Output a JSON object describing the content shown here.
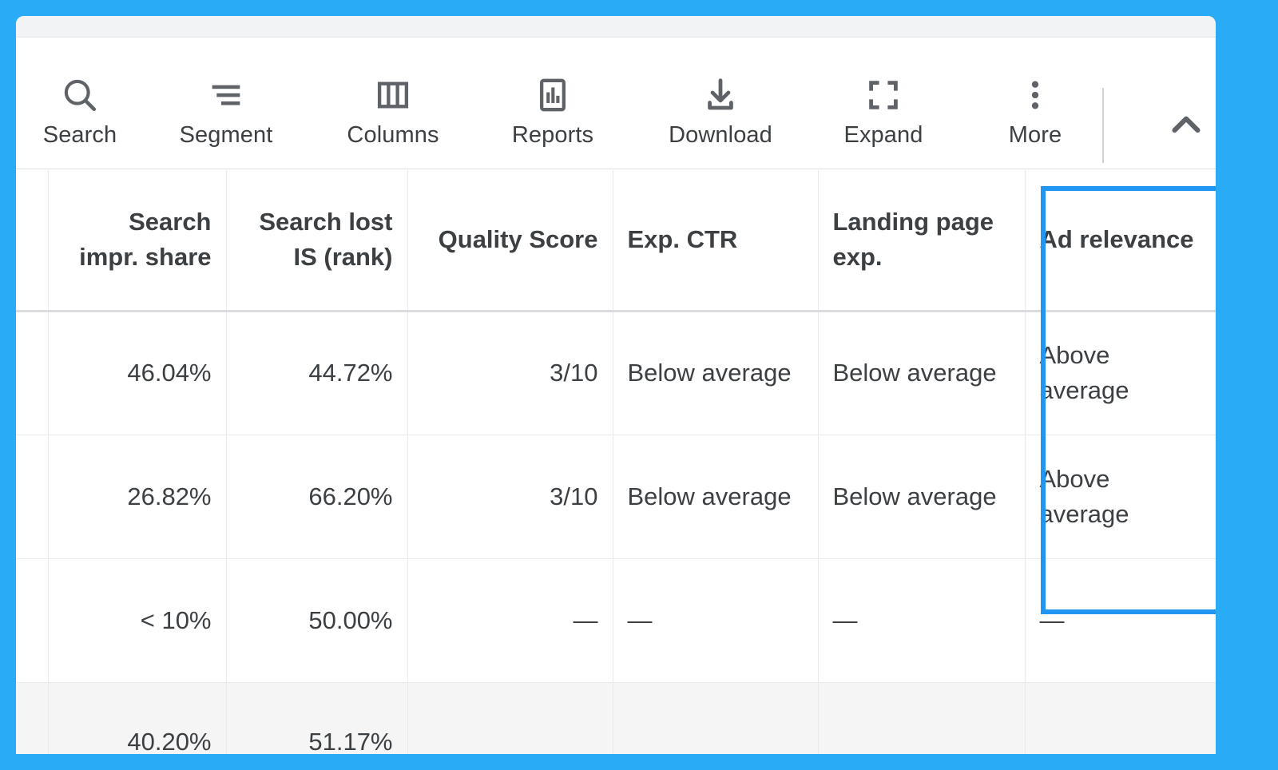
{
  "theme": {
    "accent": "#2196f3",
    "text": "#3c4043",
    "grid_line": "#e8eaed",
    "strip": "#f1f3f4"
  },
  "toolbar": {
    "items": [
      {
        "label": "Search",
        "icon": "search-icon"
      },
      {
        "label": "Segment",
        "icon": "segment-icon"
      },
      {
        "label": "Columns",
        "icon": "columns-icon"
      },
      {
        "label": "Reports",
        "icon": "reports-icon"
      },
      {
        "label": "Download",
        "icon": "download-icon"
      },
      {
        "label": "Expand",
        "icon": "expand-icon"
      },
      {
        "label": "More",
        "icon": "more-vert-icon"
      }
    ],
    "collapse_icon": "chevron-up-icon"
  },
  "table": {
    "columns": [
      {
        "id": "search_impr_share",
        "header": "Search impr. share",
        "align": "right"
      },
      {
        "id": "search_lost_is_rank",
        "header": "Search lost IS (rank)",
        "align": "right"
      },
      {
        "id": "quality_score",
        "header": "Quality Score",
        "align": "right"
      },
      {
        "id": "exp_ctr",
        "header": "Exp. CTR",
        "align": "left"
      },
      {
        "id": "landing_page_exp",
        "header": "Landing page exp.",
        "align": "left"
      },
      {
        "id": "ad_relevance",
        "header": "Ad relevance",
        "align": "left",
        "highlighted": true
      }
    ],
    "rows": [
      {
        "search_impr_share": "46.04%",
        "search_lost_is_rank": "44.72%",
        "quality_score": "3/10",
        "exp_ctr": "Below average",
        "landing_page_exp": "Below average",
        "ad_relevance": "Above average"
      },
      {
        "search_impr_share": "26.82%",
        "search_lost_is_rank": "66.20%",
        "quality_score": "3/10",
        "exp_ctr": "Below average",
        "landing_page_exp": "Below average",
        "ad_relevance": "Above average"
      },
      {
        "search_impr_share": "< 10%",
        "search_lost_is_rank": "50.00%",
        "quality_score": "—",
        "exp_ctr": "—",
        "landing_page_exp": "—",
        "ad_relevance": "—"
      }
    ],
    "partial_row": {
      "search_impr_share": "40.20%",
      "search_lost_is_rank": "51.17%",
      "quality_score": "",
      "exp_ctr": "",
      "landing_page_exp": "",
      "ad_relevance": ""
    }
  }
}
